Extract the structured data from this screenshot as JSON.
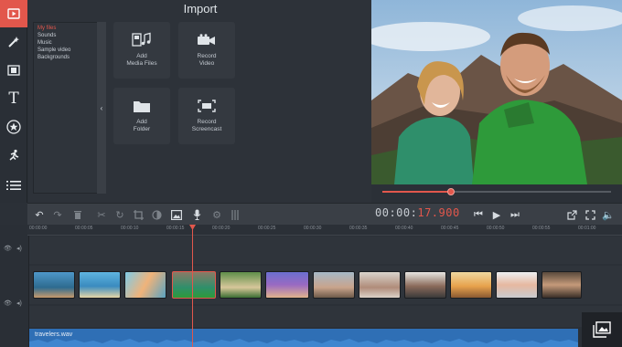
{
  "colors": {
    "accent": "#e2574c",
    "audio": "#2f6fb5",
    "panel": "#2b3037"
  },
  "sidebar_icons": [
    "media-import-icon",
    "magic-wand-icon",
    "film-strip-icon",
    "text-icon",
    "star-badge-icon",
    "running-man-icon",
    "list-icon"
  ],
  "file_tree": {
    "items": [
      {
        "label": "My files",
        "selected": true
      },
      {
        "label": "Sounds",
        "selected": false
      },
      {
        "label": "Music",
        "selected": false
      },
      {
        "label": "Sample video",
        "selected": false
      },
      {
        "label": "Backgrounds",
        "selected": false
      }
    ]
  },
  "import": {
    "title": "Import",
    "buttons": [
      {
        "label": "Add\nMedia Files",
        "icon": "add-media-files-icon"
      },
      {
        "label": "Record\nVideo",
        "icon": "video-camera-icon"
      },
      {
        "label": "Add\nFolder",
        "icon": "folder-icon"
      },
      {
        "label": "Record\nScreencast",
        "icon": "screencast-icon"
      }
    ]
  },
  "preview": {
    "progress": 0.3
  },
  "editor": {
    "timecode_main": "00:00:",
    "timecode_frac": "17.900"
  },
  "ruler": {
    "ticks": [
      "00:00:00",
      "00:00:05",
      "00:00:10",
      "00:00:15",
      "00:00:20",
      "00:00:25",
      "00:00:30",
      "00:00:35",
      "00:00:40",
      "00:00:45",
      "00:00:50",
      "00:00:55",
      "00:01:00"
    ]
  },
  "audio": {
    "filename": "travelers.wav"
  }
}
